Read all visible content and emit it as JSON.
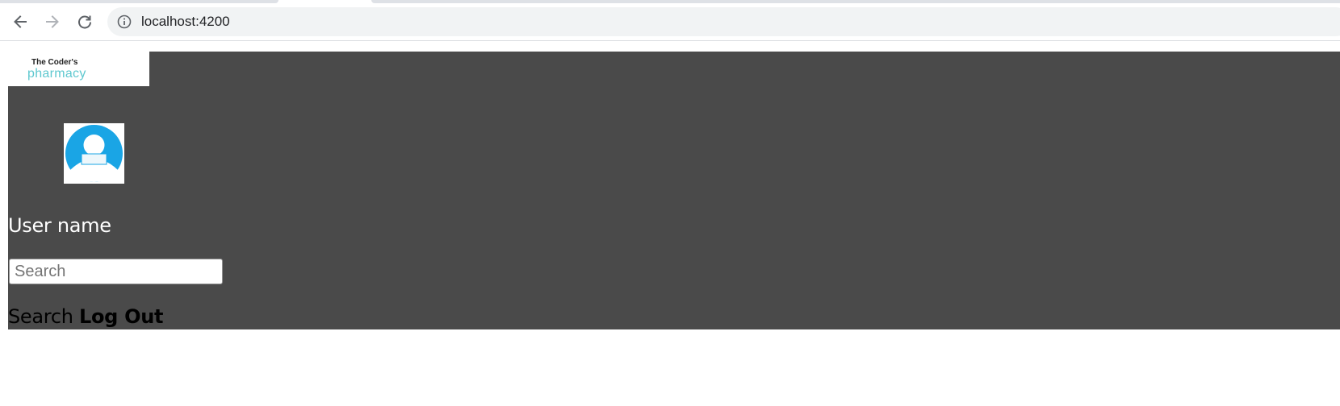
{
  "browser": {
    "url": "localhost:4200",
    "icons": {
      "back": "arrow-left-icon",
      "forward": "arrow-right-icon",
      "reload": "reload-icon",
      "site_info": "info-circle-icon"
    }
  },
  "app": {
    "logo": {
      "line1": "The Coder's",
      "line2": "pharmacy"
    },
    "avatar_icon": "user-avatar-icon",
    "user_name": "User name",
    "search": {
      "placeholder": "Search",
      "value": ""
    },
    "search_link": "Search",
    "logout_link": "Log Out"
  },
  "colors": {
    "app_bar": "#4a4a4a",
    "logo_accent": "#5ec8cf",
    "avatar_accent": "#1aa5e5",
    "omnibox_bg": "#f1f3f4"
  }
}
